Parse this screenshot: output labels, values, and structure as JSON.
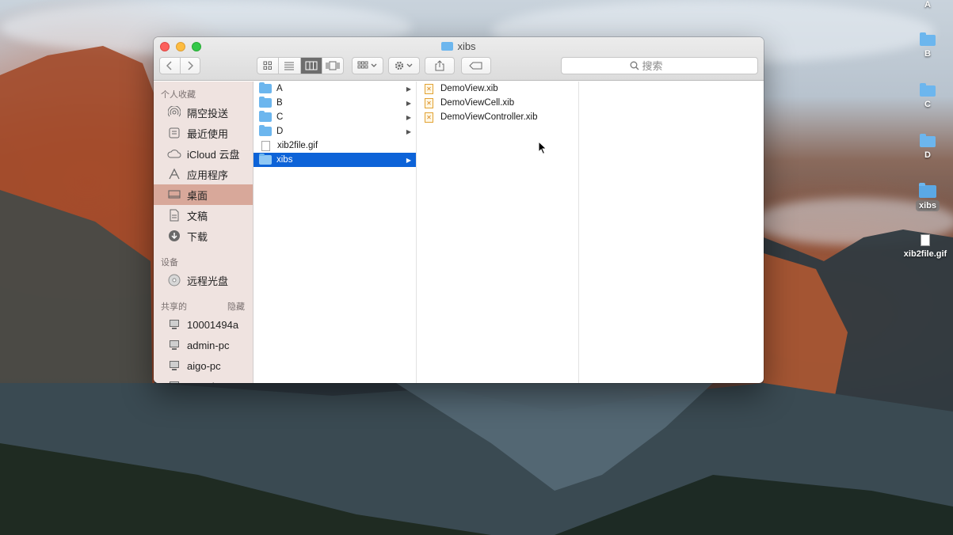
{
  "window": {
    "title": "xibs",
    "search_placeholder": "搜索"
  },
  "toolbar": {
    "back_icon": "chevron-left-icon",
    "forward_icon": "chevron-right-icon",
    "view_modes": [
      "icon-view",
      "list-view",
      "column-view",
      "coverflow-view"
    ],
    "active_view": "column-view"
  },
  "sidebar": {
    "favorites_header": "个人收藏",
    "favorites": [
      {
        "label": "隔空投送",
        "icon": "airdrop-icon"
      },
      {
        "label": "最近使用",
        "icon": "recents-icon"
      },
      {
        "label": "iCloud 云盘",
        "icon": "cloud-icon"
      },
      {
        "label": "应用程序",
        "icon": "applications-icon"
      },
      {
        "label": "桌面",
        "icon": "desktop-icon",
        "selected": true
      },
      {
        "label": "文稿",
        "icon": "documents-icon"
      },
      {
        "label": "下载",
        "icon": "download-icon"
      }
    ],
    "devices_header": "设备",
    "devices": [
      {
        "label": "远程光盘",
        "icon": "disc-icon"
      }
    ],
    "shared_header": "共享的",
    "shared_hide": "隐藏",
    "shared": [
      {
        "label": "10001494a",
        "icon": "computer-icon"
      },
      {
        "label": "admin-pc",
        "icon": "computer-icon"
      },
      {
        "label": "aigo-pc",
        "icon": "computer-icon"
      },
      {
        "label": "coco-hp",
        "icon": "computer-icon"
      }
    ]
  },
  "columns": {
    "col1": [
      {
        "name": "A",
        "type": "folder"
      },
      {
        "name": "B",
        "type": "folder"
      },
      {
        "name": "C",
        "type": "folder"
      },
      {
        "name": "D",
        "type": "folder"
      },
      {
        "name": "xib2file.gif",
        "type": "file"
      },
      {
        "name": "xibs",
        "type": "folder",
        "selected": true
      }
    ],
    "col2": [
      {
        "name": "DemoView.xib",
        "type": "xib"
      },
      {
        "name": "DemoViewCell.xib",
        "type": "xib"
      },
      {
        "name": "DemoViewController.xib",
        "type": "xib"
      }
    ]
  },
  "desktop": {
    "items": [
      {
        "label": "A"
      },
      {
        "label": "B"
      },
      {
        "label": "C"
      },
      {
        "label": "D"
      },
      {
        "label": "xibs",
        "selected": true
      },
      {
        "label": "xib2file.gif"
      }
    ]
  }
}
